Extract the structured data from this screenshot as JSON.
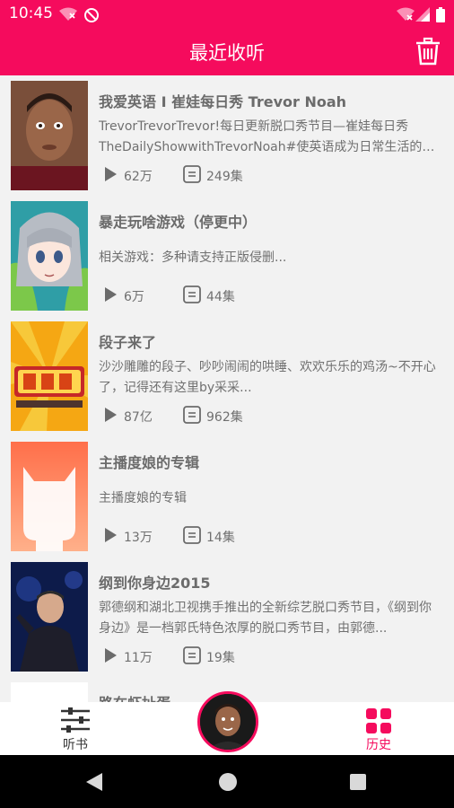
{
  "status_bar": {
    "time": "10:45"
  },
  "app_bar": {
    "title": "最近收听"
  },
  "items": [
    {
      "title": "我爱英语 I 崔娃每日秀 Trevor Noah",
      "description": "TrevorTrevorTrevor!每日更新脱口秀节目—崔娃每日秀TheDailyShowwithTrevorNoah#使英语成为日常生活的…",
      "plays": "62万",
      "episodes": "249集"
    },
    {
      "title": "暴走玩啥游戏（停更中）",
      "description": "相关游戏：多种请支持正版侵删...",
      "plays": "6万",
      "episodes": "44集"
    },
    {
      "title": "段子来了",
      "description": "沙沙雕雕的段子、吵吵闹闹的哄睡、欢欢乐乐的鸡汤~不开心了，记得还有这里by采采...",
      "plays": "87亿",
      "episodes": "962集"
    },
    {
      "title": "主播度娘的专辑",
      "description": "主播度娘的专辑",
      "plays": "13万",
      "episodes": "14集"
    },
    {
      "title": "纲到你身边2015",
      "description": "郭德纲和湖北卫视携手推出的全新综艺脱口秀节目，《纲到你身边》是一档郭氏特色浓厚的脱口秀节目，由郭德...",
      "plays": "11万",
      "episodes": "19集"
    },
    {
      "title": "路在虾扯蛋",
      "description": "",
      "plays": "",
      "episodes": ""
    }
  ],
  "bottom_nav": {
    "tabs": [
      {
        "label": "听书",
        "icon": "sliders-icon",
        "color": "#333333"
      },
      {
        "label": "历史",
        "icon": "grid-icon",
        "color": "#f50b5d"
      }
    ]
  },
  "colors": {
    "accent": "#f50b5d",
    "background": "#f2f2f2"
  }
}
